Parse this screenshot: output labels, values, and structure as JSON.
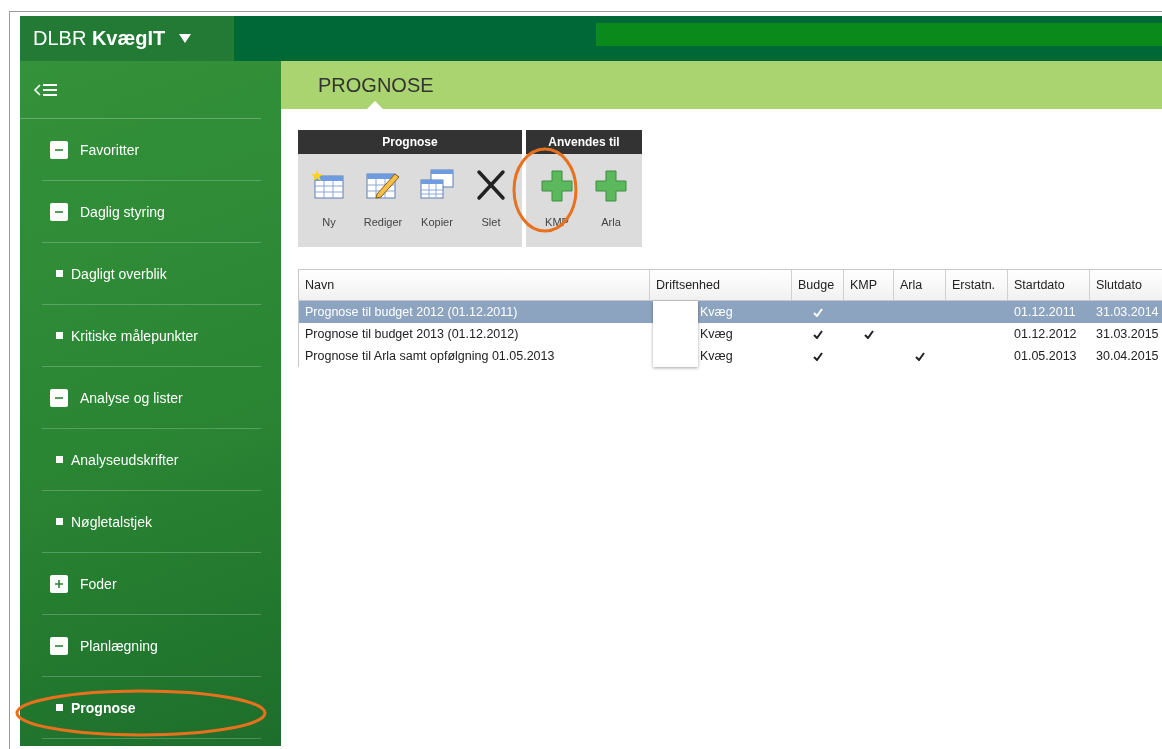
{
  "app": {
    "brand": "DLBR **KvægIT**"
  },
  "sidebar": {
    "items": [
      {
        "label": "Favoritter",
        "expanded": true,
        "selected": false
      },
      {
        "label": "Daglig styring",
        "expanded": true,
        "selected": false,
        "children": [
          {
            "label": "Dagligt overblik",
            "selected": false
          },
          {
            "label": "Kritiske målepunkter",
            "selected": false
          }
        ]
      },
      {
        "label": "Analyse og lister",
        "expanded": true,
        "selected": false,
        "children": [
          {
            "label": "Analyseudskrifter",
            "selected": false
          },
          {
            "label": "Nøgletalstjek",
            "selected": false
          }
        ]
      },
      {
        "label": "Foder",
        "expanded": false,
        "selected": false
      },
      {
        "label": "Planlægning",
        "expanded": true,
        "selected": false,
        "children": [
          {
            "label": "Prognose",
            "selected": true
          }
        ]
      }
    ]
  },
  "page_title": "PROGNOSE",
  "toolbar": {
    "groups": [
      {
        "title": "Prognose",
        "buttons": [
          {
            "label": "Ny",
            "kind": "new"
          },
          {
            "label": "Rediger",
            "kind": "edit"
          },
          {
            "label": "Kopier",
            "kind": "copy"
          },
          {
            "label": "Slet",
            "kind": "delete"
          }
        ]
      },
      {
        "title": "Anvendes til",
        "buttons": [
          {
            "label": "KMP",
            "kind": "add"
          },
          {
            "label": "Arla",
            "kind": "add"
          }
        ]
      }
    ]
  },
  "table": {
    "columns": [
      "Navn",
      "Driftsenhed",
      "Budge",
      "KMP",
      "Arla",
      "Erstatn.",
      "Startdato",
      "Slutdato"
    ],
    "rows": [
      {
        "name": "Prognose til budget 2012 (01.12.2011)",
        "unit": "Kvæg",
        "budget": true,
        "kmp": false,
        "arla": false,
        "erstatn": false,
        "start": "01.12.2011",
        "end": "31.03.2014",
        "selected": true
      },
      {
        "name": "Prognose til budget 2013 (01.12.2012)",
        "unit": "Kvæg",
        "budget": true,
        "kmp": true,
        "arla": false,
        "erstatn": false,
        "start": "01.12.2012",
        "end": "31.03.2015",
        "selected": false
      },
      {
        "name": "Prognose til Arla samt opfølgning 01.05.2013",
        "unit": "Kvæg",
        "budget": true,
        "kmp": false,
        "arla": true,
        "erstatn": false,
        "start": "01.05.2013",
        "end": "30.04.2015",
        "selected": false
      }
    ]
  }
}
